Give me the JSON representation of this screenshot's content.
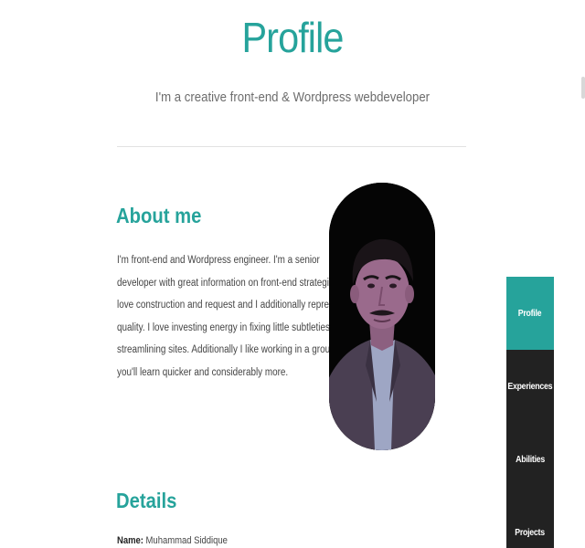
{
  "header": {
    "title": "Profile",
    "subtitle": "I'm a creative front-end & Wordpress webdeveloper"
  },
  "about": {
    "heading": "About me",
    "lines": [
      "I'm front-end and Wordpress engineer. I'm a senior",
      "developer with great information on front-end strategies. I",
      "love construction and request and I additionally represent",
      "quality. I love investing energy in fixing little subtleties and",
      "streamlining sites. Additionally I like working in a group,",
      "you'll learn quicker and considerably more."
    ],
    "photo_icon": "profile-portrait"
  },
  "details": {
    "heading": "Details",
    "name_label": "Name:",
    "name_value": "Muhammad Siddique"
  },
  "side_nav": {
    "items": [
      {
        "label": "Profile",
        "active": true
      },
      {
        "label": "Experiences",
        "active": false
      },
      {
        "label": "Abilities",
        "active": false
      },
      {
        "label": "Projects",
        "active": false
      }
    ]
  },
  "colors": {
    "accent": "#26a39b",
    "nav_bg": "#222222",
    "text": "#444444"
  }
}
